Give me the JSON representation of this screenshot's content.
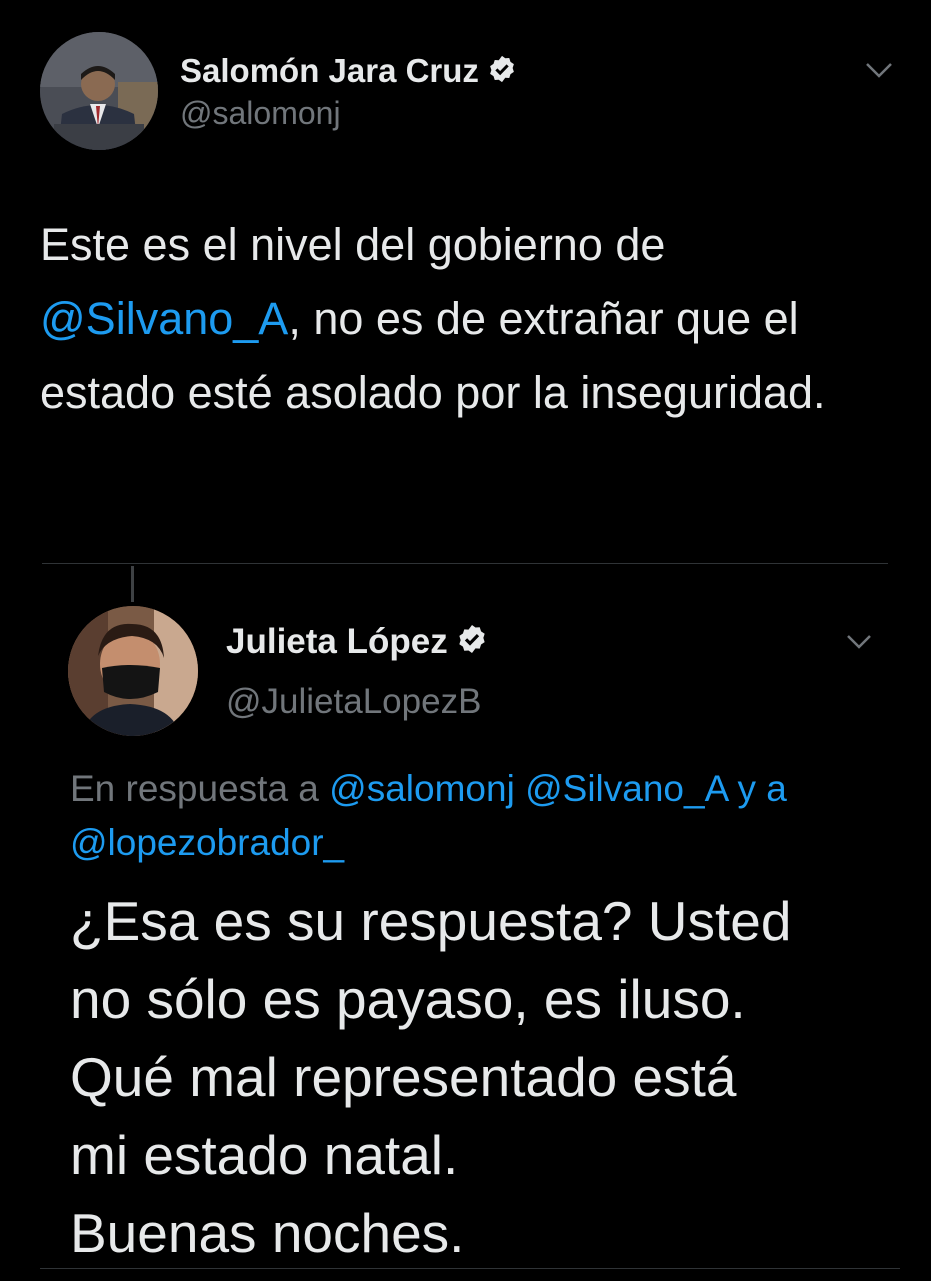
{
  "main_tweet": {
    "author_name": "Salomón Jara Cruz",
    "author_handle": "@salomonj",
    "text_before": "Este es el nivel del gobierno de ",
    "mention": "@Silvano_A",
    "text_after": ", no es de extrañar que el estado esté asolado por la inseguridad."
  },
  "quoted_tweet": {
    "author_name": "Julieta López",
    "author_handle": "@JulietaLopezB",
    "reply_prefix": "En respuesta a ",
    "reply_mentions": [
      "@salomonj",
      "@Silvano_A"
    ],
    "reply_joiner": " y a ",
    "reply_last_mention": "@lopezobrador_",
    "lines": [
      "¿Esa es su respuesta? Usted",
      "no sólo es payaso, es iluso.",
      "Qué mal representado está",
      "mi estado natal.",
      "Buenas noches."
    ]
  },
  "icons": {
    "verified": "verified-badge-icon",
    "menu": "chevron-down-icon"
  },
  "colors": {
    "background": "#000000",
    "text": "#e7e9ea",
    "muted": "#71767b",
    "link": "#1d9bf0"
  }
}
